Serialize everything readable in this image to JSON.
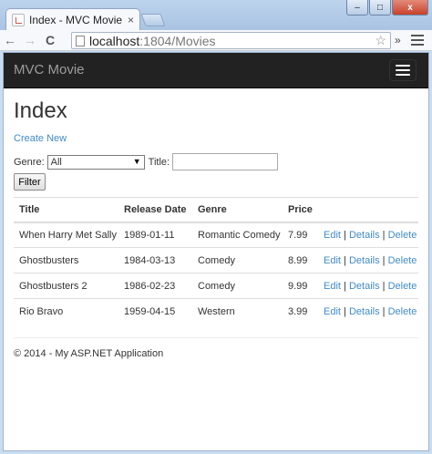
{
  "browser": {
    "tab_title": "Index - MVC Movie",
    "tab_close": "×",
    "url_host": "localhost",
    "url_rest": ":1804/Movies",
    "back_glyph": "←",
    "forward_glyph": "→",
    "reload_glyph": "C",
    "star_glyph": "☆",
    "extensions_glyph": "»",
    "window_controls": [
      "–",
      "□",
      "x"
    ]
  },
  "site": {
    "brand": "MVC Movie"
  },
  "page": {
    "heading": "Index",
    "create_link": "Create New",
    "filter": {
      "genre_label": "Genre:",
      "genre_selected": "All",
      "title_label": "Title:",
      "title_value": "",
      "button_label": "Filter"
    },
    "table": {
      "headers": [
        "Title",
        "Release Date",
        "Genre",
        "Price"
      ],
      "action_labels": {
        "edit": "Edit",
        "details": "Details",
        "delete": "Delete",
        "sep": "|"
      },
      "rows": [
        {
          "title": "When Harry Met Sally",
          "release_date": "1989-01-11",
          "genre": "Romantic Comedy",
          "price": "7.99"
        },
        {
          "title": "Ghostbusters",
          "release_date": "1984-03-13",
          "genre": "Comedy",
          "price": "8.99"
        },
        {
          "title": "Ghostbusters 2",
          "release_date": "1986-02-23",
          "genre": "Comedy",
          "price": "9.99"
        },
        {
          "title": "Rio Bravo",
          "release_date": "1959-04-15",
          "genre": "Western",
          "price": "3.99"
        }
      ]
    },
    "footer": "© 2014 - My ASP.NET Application"
  },
  "colors": {
    "navbar_bg": "#222222",
    "brand_text": "#9d9d9d",
    "link": "#428bca"
  },
  "icons": [
    "tab-favicon-icon",
    "close-icon",
    "back-arrow-icon",
    "forward-arrow-icon",
    "reload-icon",
    "page-icon",
    "bookmark-star-icon",
    "chrome-menu-icon",
    "hamburger-menu-icon",
    "dropdown-arrow-icon"
  ]
}
